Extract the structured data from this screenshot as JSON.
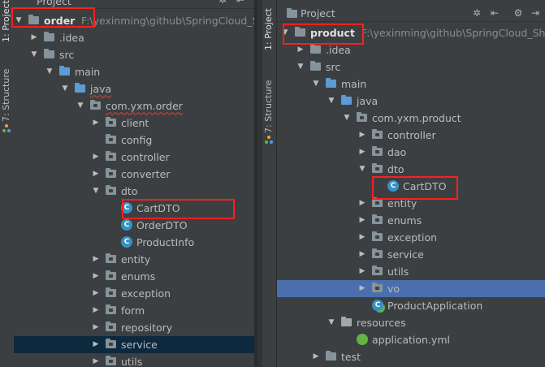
{
  "left_panel": {
    "tool_window_tabs": [
      "1: Project",
      "7: Structure"
    ],
    "header": {
      "title": "Project"
    },
    "tree": [
      {
        "label": "order",
        "path": "F:\\yexinming\\github\\SpringCloud_Shell"
      },
      {
        "label": ".idea"
      },
      {
        "label": "src"
      },
      {
        "label": "main"
      },
      {
        "label": "java"
      },
      {
        "label": "com.yxm.order"
      },
      {
        "label": "client"
      },
      {
        "label": "config"
      },
      {
        "label": "controller"
      },
      {
        "label": "converter"
      },
      {
        "label": "dto"
      },
      {
        "label": "CartDTO"
      },
      {
        "label": "OrderDTO"
      },
      {
        "label": "ProductInfo"
      },
      {
        "label": "entity"
      },
      {
        "label": "enums"
      },
      {
        "label": "exception"
      },
      {
        "label": "form"
      },
      {
        "label": "repository"
      },
      {
        "label": "service"
      },
      {
        "label": "utils"
      }
    ]
  },
  "right_panel": {
    "tool_window_tabs": [
      "1: Project",
      "7: Structure"
    ],
    "header": {
      "title": "Project"
    },
    "tree": [
      {
        "label": "product",
        "path": "F:\\yexinming\\github\\SpringCloud_Shell\\p"
      },
      {
        "label": ".idea"
      },
      {
        "label": "src"
      },
      {
        "label": "main"
      },
      {
        "label": "java"
      },
      {
        "label": "com.yxm.product"
      },
      {
        "label": "controller"
      },
      {
        "label": "dao"
      },
      {
        "label": "dto"
      },
      {
        "label": "CartDTO"
      },
      {
        "label": "entity"
      },
      {
        "label": "enums"
      },
      {
        "label": "exception"
      },
      {
        "label": "service"
      },
      {
        "label": "utils"
      },
      {
        "label": "vo"
      },
      {
        "label": "ProductApplication"
      },
      {
        "label": "resources"
      },
      {
        "label": "application.yml"
      },
      {
        "label": "test"
      }
    ]
  },
  "icons": {
    "class_letter": "C",
    "expanded": "▼",
    "collapsed": "▶",
    "settings": "✲",
    "collapse_all": "⇤"
  },
  "colors": {
    "highlight_box": "#ff1f1f",
    "selection": "#4b6eaf",
    "class_icon": "#3592c4"
  }
}
